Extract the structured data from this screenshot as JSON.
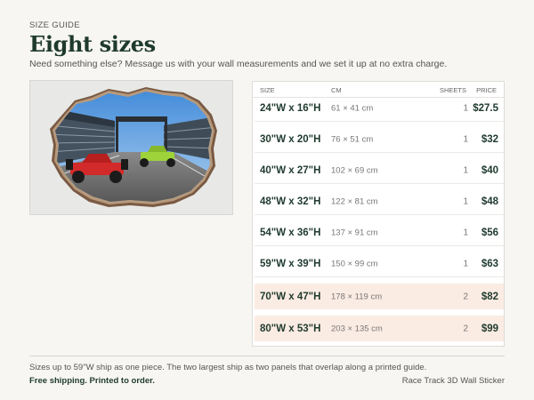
{
  "header": {
    "eyebrow": "SIZE GUIDE",
    "title": "Eight sizes",
    "subtitle": "Need something else? Message us with your wall measurements and we set it up at no extra charge."
  },
  "preview": {
    "alt": "Race Track 3D Wall Sticker preview",
    "car_colors": [
      "#d22a2a",
      "#9fd33a"
    ]
  },
  "table": {
    "headers": {
      "size": "SIZE",
      "cm": "CM",
      "sheets": "SHEETS",
      "price": "PRICE"
    },
    "rows": [
      {
        "size": "24\"W x 16\"H",
        "cm": "61 × 41 cm",
        "sheets": "1",
        "price": "$27.5",
        "highlight": false
      },
      {
        "size": "30\"W x 20\"H",
        "cm": "76 × 51 cm",
        "sheets": "1",
        "price": "$32",
        "highlight": false
      },
      {
        "size": "40\"W x 27\"H",
        "cm": "102 × 69 cm",
        "sheets": "1",
        "price": "$40",
        "highlight": false
      },
      {
        "size": "48\"W x 32\"H",
        "cm": "122 × 81 cm",
        "sheets": "1",
        "price": "$48",
        "highlight": false
      },
      {
        "size": "54\"W x 36\"H",
        "cm": "137 × 91 cm",
        "sheets": "1",
        "price": "$56",
        "highlight": false
      },
      {
        "size": "59\"W x 39\"H",
        "cm": "150 × 99 cm",
        "sheets": "1",
        "price": "$63",
        "highlight": false
      },
      {
        "size": "70\"W x 47\"H",
        "cm": "178 × 119 cm",
        "sheets": "2",
        "price": "$82",
        "highlight": true
      },
      {
        "size": "80\"W x 53\"H",
        "cm": "203 × 135 cm",
        "sheets": "2",
        "price": "$99",
        "highlight": true
      }
    ]
  },
  "footer": {
    "note": "Sizes up to 59\"W ship as one piece. The two largest ship as two panels that overlap along a printed guide.",
    "shipping": "Free shipping. Printed to order.",
    "product_name": "Race Track 3D Wall Sticker"
  },
  "colors": {
    "accent": "#1f3a2e",
    "highlight_row": "#fbece3",
    "background": "#f7f6f3"
  }
}
